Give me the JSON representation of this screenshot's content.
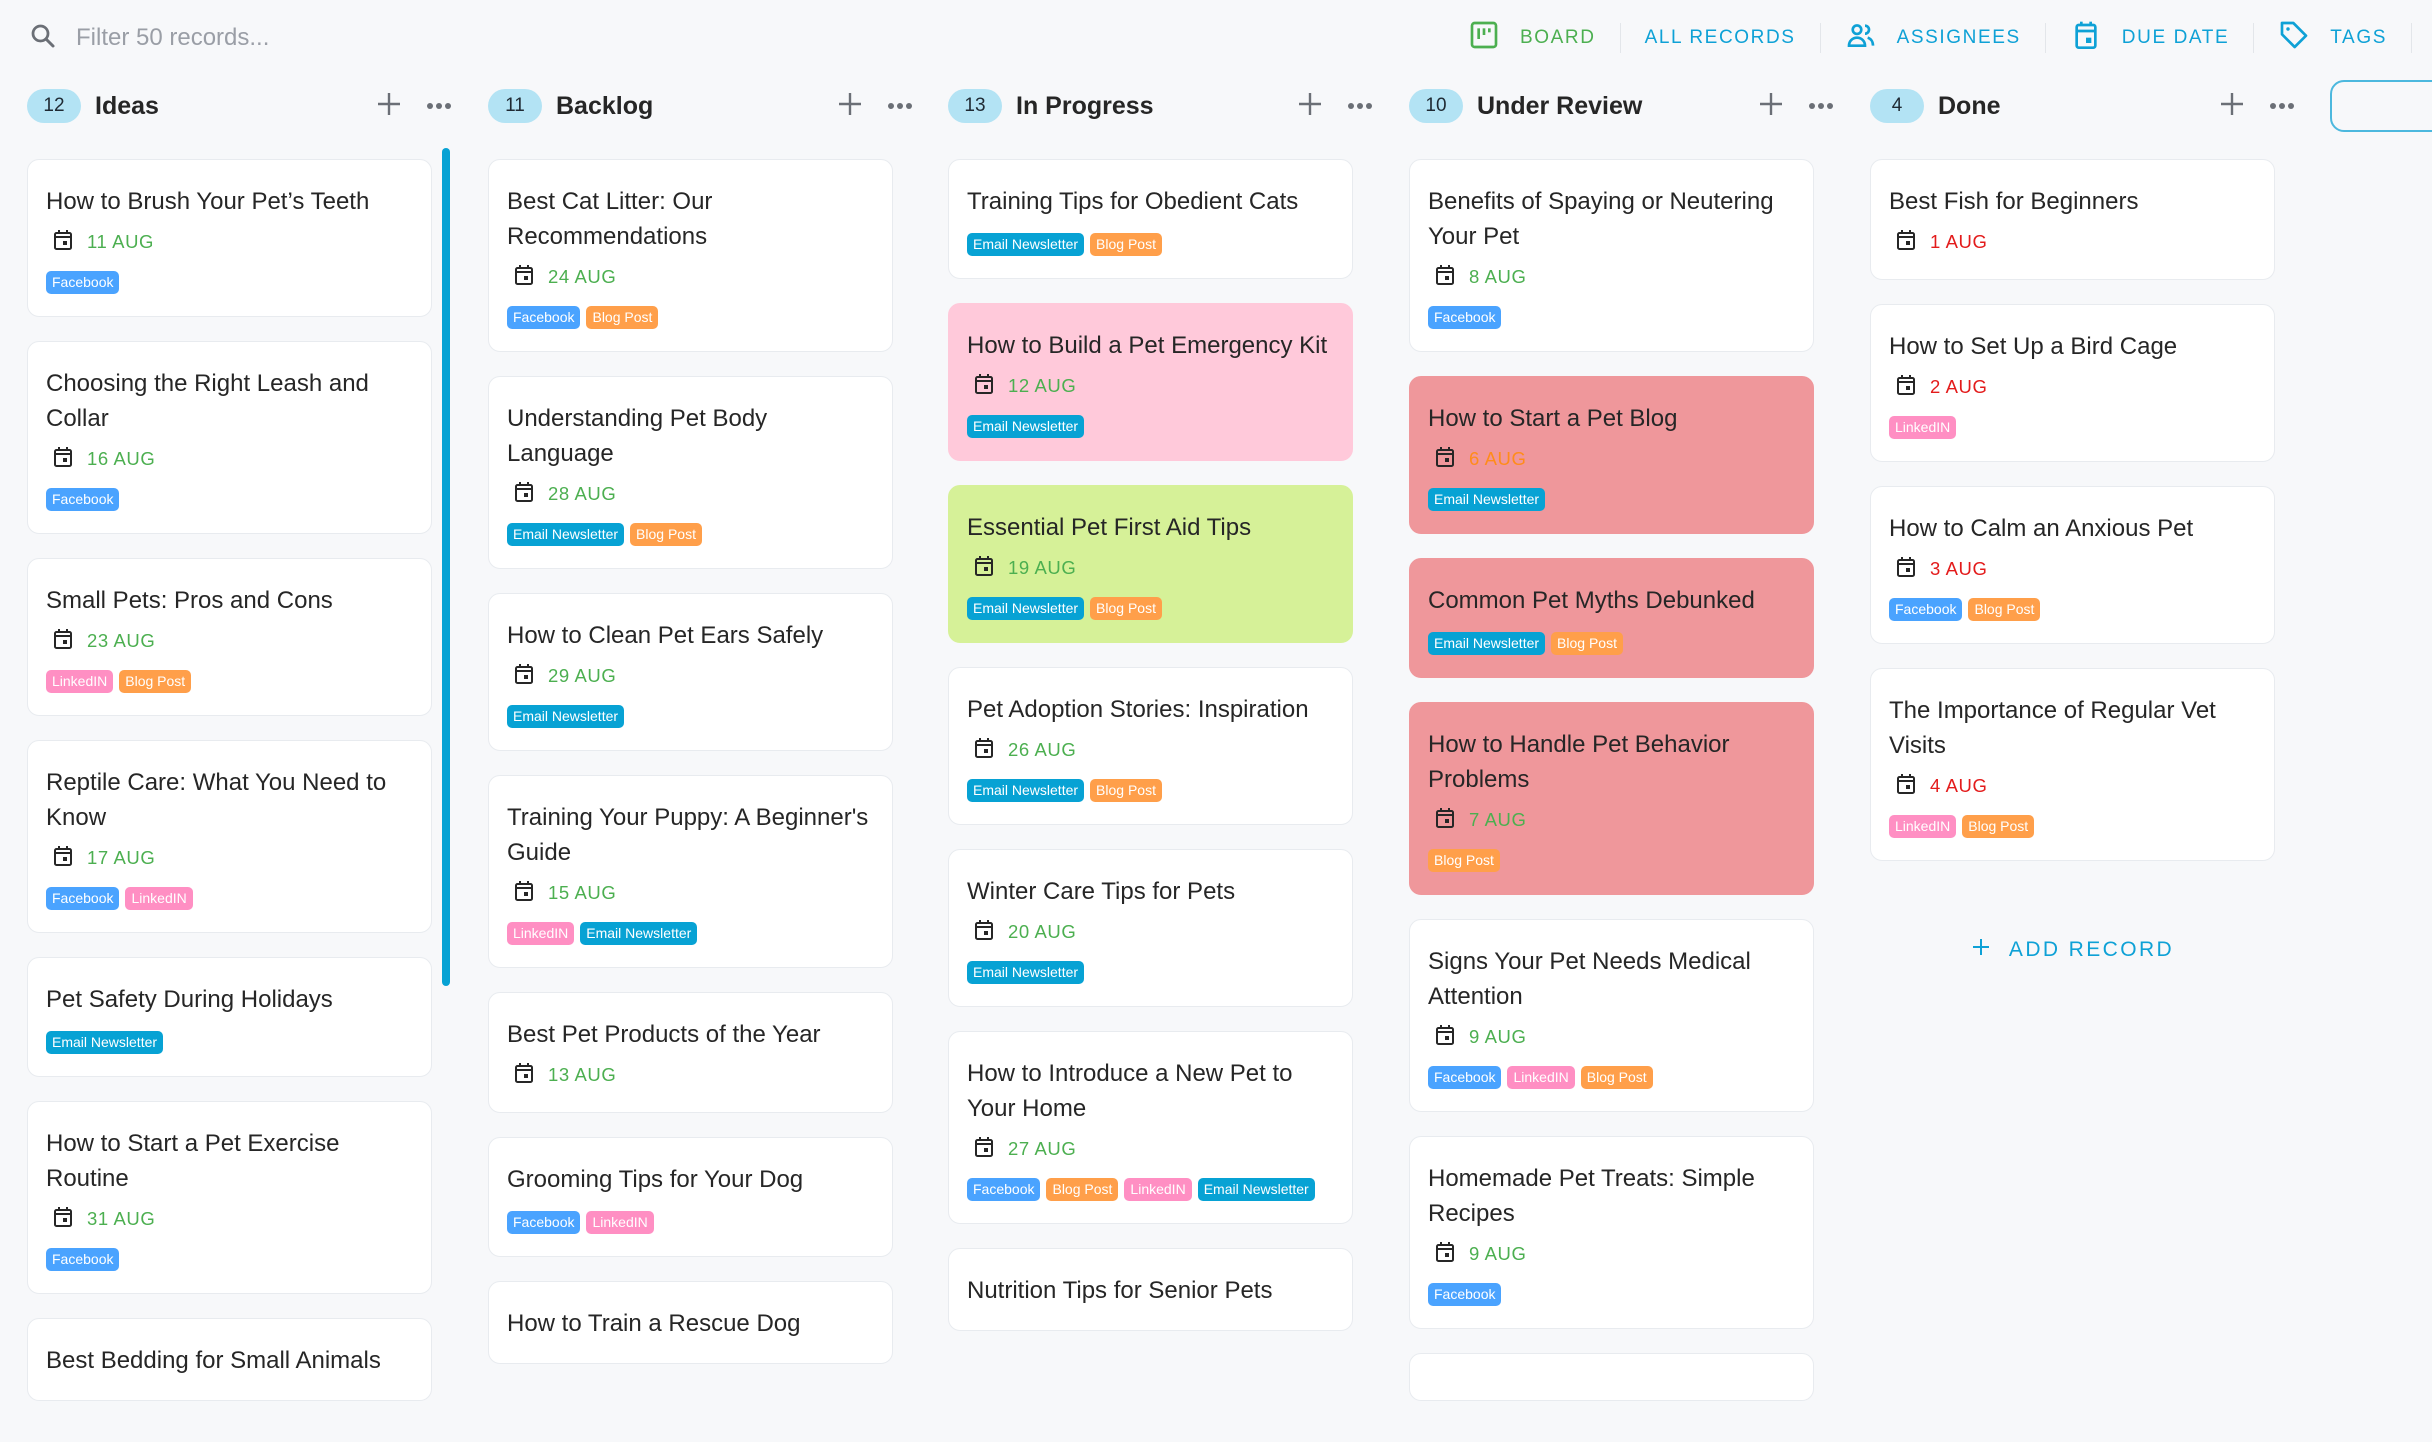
{
  "search": {
    "placeholder": "Filter 50 records...",
    "value": ""
  },
  "views": [
    {
      "label": "BOARD",
      "icon": "board-icon",
      "active": true
    },
    {
      "label": "ALL RECORDS",
      "icon": null,
      "active": false
    },
    {
      "label": "ASSIGNEES",
      "icon": "people-icon",
      "active": false
    },
    {
      "label": "DUE DATE",
      "icon": "calendar-icon",
      "active": false
    },
    {
      "label": "TAGS",
      "icon": "tag-icon",
      "active": false
    }
  ],
  "colors": {
    "accent": "#0ea1d6",
    "active_view": "#4caf50",
    "date_ok": "#4caf50",
    "date_overdue": "#e31b1b",
    "date_soon": "#ff8c1a",
    "tag_facebook": "#4aa3ff",
    "tag_linkedin": "#ff8fc3",
    "tag_blog": "#ff9f4a",
    "tag_email": "#07a2d4",
    "card_pink": "#ffc9da",
    "card_lime": "#d6f198",
    "card_red": "#ef979b"
  },
  "add_record_label": "ADD RECORD",
  "columns": [
    {
      "title": "Ideas",
      "count": "12",
      "cards": [
        {
          "title": "How to Brush Your Pet’s Teeth",
          "date": "11 AUG",
          "date_status": "green",
          "tags": [
            "Facebook"
          ]
        },
        {
          "title": "Choosing the Right Leash and Collar",
          "date": "16 AUG",
          "date_status": "green",
          "tags": [
            "Facebook"
          ]
        },
        {
          "title": "Small Pets: Pros and Cons",
          "date": "23 AUG",
          "date_status": "green",
          "tags": [
            "LinkedIN",
            "Blog Post"
          ]
        },
        {
          "title": "Reptile Care: What You Need to Know",
          "date": "17 AUG",
          "date_status": "green",
          "tags": [
            "Facebook",
            "LinkedIN"
          ]
        },
        {
          "title": "Pet Safety During Holidays",
          "date": null,
          "tags": [
            "Email Newsletter"
          ]
        },
        {
          "title": "How to Start a Pet Exercise Routine",
          "date": "31 AUG",
          "date_status": "green",
          "tags": [
            "Facebook"
          ]
        },
        {
          "title": "Best Bedding for Small Animals",
          "date": null,
          "tags": []
        }
      ]
    },
    {
      "title": "Backlog",
      "count": "11",
      "cards": [
        {
          "title": "Best Cat Litter: Our Recommendations",
          "date": "24 AUG",
          "date_status": "green",
          "tags": [
            "Facebook",
            "Blog Post"
          ]
        },
        {
          "title": "Understanding Pet Body Language",
          "date": "28 AUG",
          "date_status": "green",
          "tags": [
            "Email Newsletter",
            "Blog Post"
          ]
        },
        {
          "title": "How to Clean Pet Ears Safely",
          "date": "29 AUG",
          "date_status": "green",
          "tags": [
            "Email Newsletter"
          ]
        },
        {
          "title": "Training Your Puppy: A Beginner's Guide",
          "date": "15 AUG",
          "date_status": "green",
          "tags": [
            "LinkedIN",
            "Email Newsletter"
          ]
        },
        {
          "title": "Best Pet Products of the Year",
          "date": "13 AUG",
          "date_status": "green",
          "tags": []
        },
        {
          "title": "Grooming Tips for Your Dog",
          "date": null,
          "tags": [
            "Facebook",
            "LinkedIN"
          ]
        },
        {
          "title": "How to Train a Rescue Dog",
          "date": null,
          "tags": []
        }
      ]
    },
    {
      "title": "In Progress",
      "count": "13",
      "cards": [
        {
          "title": "Training Tips for Obedient Cats",
          "date": null,
          "tags": [
            "Email Newsletter",
            "Blog Post"
          ]
        },
        {
          "title": "How to Build a Pet Emergency Kit",
          "date": "12 AUG",
          "date_status": "green",
          "tags": [
            "Email Newsletter"
          ],
          "color": "pink"
        },
        {
          "title": "Essential Pet First Aid Tips",
          "date": "19 AUG",
          "date_status": "green",
          "tags": [
            "Email Newsletter",
            "Blog Post"
          ],
          "color": "lime"
        },
        {
          "title": "Pet Adoption Stories: Inspiration",
          "date": "26 AUG",
          "date_status": "green",
          "tags": [
            "Email Newsletter",
            "Blog Post"
          ]
        },
        {
          "title": "Winter Care Tips for Pets",
          "date": "20 AUG",
          "date_status": "green",
          "tags": [
            "Email Newsletter"
          ]
        },
        {
          "title": "How to Introduce a New Pet to Your Home",
          "date": "27 AUG",
          "date_status": "green",
          "tags": [
            "Facebook",
            "Blog Post",
            "LinkedIN",
            "Email Newsletter"
          ]
        },
        {
          "title": "Nutrition Tips for Senior Pets",
          "date": null,
          "tags": []
        }
      ]
    },
    {
      "title": "Under Review",
      "count": "10",
      "cards": [
        {
          "title": "Benefits of Spaying or Neutering Your Pet",
          "date": "8 AUG",
          "date_status": "green",
          "tags": [
            "Facebook"
          ]
        },
        {
          "title": "How to Start a Pet Blog",
          "date": "6 AUG",
          "date_status": "orange",
          "tags": [
            "Email Newsletter"
          ],
          "color": "red"
        },
        {
          "title": "Common Pet Myths Debunked",
          "date": null,
          "tags": [
            "Email Newsletter",
            "Blog Post"
          ],
          "color": "red"
        },
        {
          "title": "How to Handle Pet Behavior Problems",
          "date": "7 AUG",
          "date_status": "green",
          "tags": [
            "Blog Post"
          ],
          "color": "red"
        },
        {
          "title": "Signs Your Pet Needs Medical Attention",
          "date": "9 AUG",
          "date_status": "green",
          "tags": [
            "Facebook",
            "LinkedIN",
            "Blog Post"
          ]
        },
        {
          "title": "Homemade Pet Treats: Simple Recipes",
          "date": "9 AUG",
          "date_status": "green",
          "tags": [
            "Facebook"
          ]
        },
        {
          "title": "",
          "date": null,
          "tags": []
        }
      ]
    },
    {
      "title": "Done",
      "count": "4",
      "cards": [
        {
          "title": "Best Fish for Beginners",
          "date": "1 AUG",
          "date_status": "red",
          "tags": []
        },
        {
          "title": "How to Set Up a Bird Cage",
          "date": "2 AUG",
          "date_status": "red",
          "tags": [
            "LinkedIN"
          ]
        },
        {
          "title": "How to Calm an Anxious Pet",
          "date": "3 AUG",
          "date_status": "red",
          "tags": [
            "Facebook",
            "Blog Post"
          ]
        },
        {
          "title": "The Importance of Regular Vet Visits",
          "date": "4 AUG",
          "date_status": "red",
          "tags": [
            "LinkedIN",
            "Blog Post"
          ]
        }
      ]
    }
  ]
}
